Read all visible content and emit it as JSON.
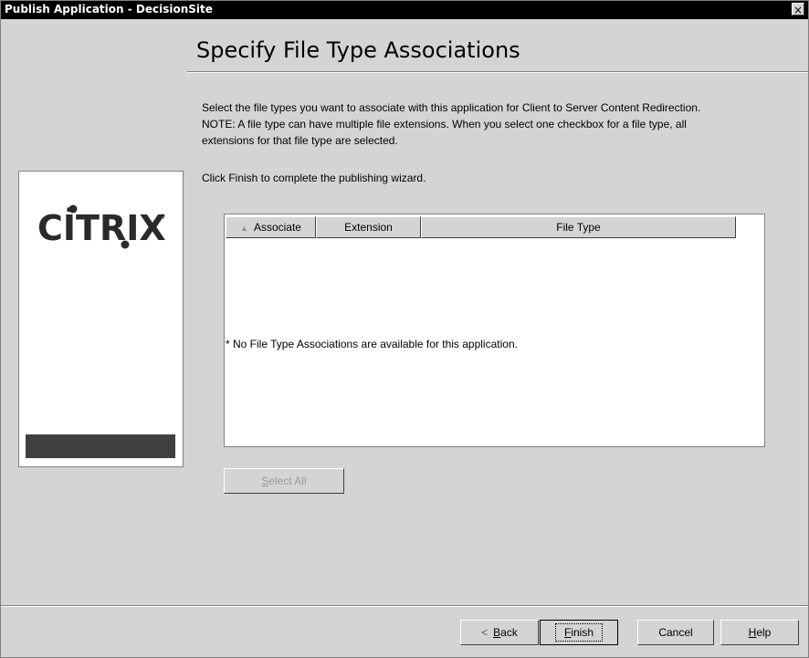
{
  "window": {
    "title": "Publish Application - DecisionSite",
    "close_glyph": "×"
  },
  "page": {
    "heading": "Specify File Type Associations",
    "description_line1": "Select the file types you want to associate with this application for Client to Server Content Redirection.",
    "description_line2": "NOTE: A file type can have multiple file extensions. When you select one checkbox for a file type, all",
    "description_line3": "extensions for that file type are selected.",
    "finish_note": "Click Finish to complete the publishing wizard."
  },
  "logo": {
    "text": "CİTRIX",
    "icon": "citrix-logo"
  },
  "list": {
    "columns": [
      "Associate",
      "Extension",
      "File Type"
    ],
    "sort_indicator": "▲",
    "rows": [],
    "empty_message": "* No File Type Associations are available for this application."
  },
  "buttons": {
    "select_all_pre": "",
    "select_all_u": "S",
    "select_all_post": "elect All",
    "back_glyph": "<",
    "back_u": "B",
    "back_post": "ack",
    "finish_u": "F",
    "finish_post": "inish",
    "cancel": "Cancel",
    "help_u": "H",
    "help_post": "elp"
  }
}
